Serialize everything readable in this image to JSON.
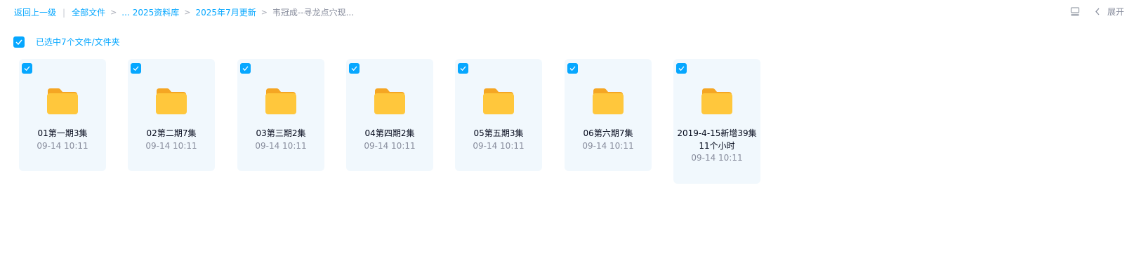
{
  "breadcrumb": {
    "back": "返回上一级",
    "all_files": "全部文件",
    "ellipsis": "...",
    "level1": "2025资料库",
    "level2": "2025年7月更新",
    "current": "韦冠成--寻龙点穴现..."
  },
  "toolbar": {
    "expand_label": "展开",
    "list_icon": "list-view-icon",
    "chevron_icon": "chevron-left-icon"
  },
  "selection": {
    "checked": true,
    "label": "已选中7个文件/文件夹"
  },
  "files": [
    {
      "name": "01第一期3集",
      "time": "09-14 10:11",
      "checked": true
    },
    {
      "name": "02第二期7集",
      "time": "09-14 10:11",
      "checked": true
    },
    {
      "name": "03第三期2集",
      "time": "09-14 10:11",
      "checked": true
    },
    {
      "name": "04第四期2集",
      "time": "09-14 10:11",
      "checked": true
    },
    {
      "name": "05第五期3集",
      "time": "09-14 10:11",
      "checked": true
    },
    {
      "name": "06第六期7集",
      "time": "09-14 10:11",
      "checked": true
    },
    {
      "name": "2019-4-15新增39集11个小时",
      "time": "09-14 10:11",
      "checked": true
    }
  ],
  "colors": {
    "accent": "#06a7ff",
    "card_bg": "#f1f8fd",
    "folder": "#ffc73c",
    "muted": "#878c9c"
  }
}
